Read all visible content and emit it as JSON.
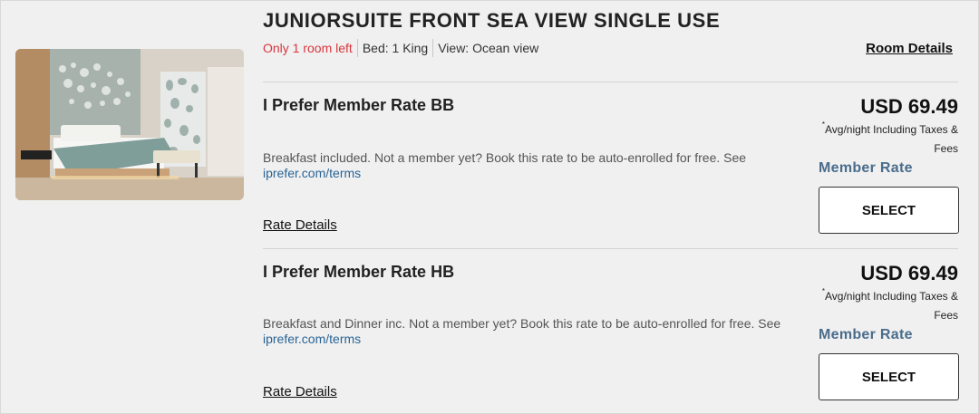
{
  "room": {
    "title": "JUNIORSUITE FRONT SEA VIEW SINGLE USE",
    "availability": "Only 1 room left",
    "bed": "Bed: 1 King",
    "view": "View: Ocean view",
    "details_link": "Room Details",
    "photo_alt": "room-photo"
  },
  "rates": [
    {
      "name": "I Prefer Member Rate BB",
      "description": "Breakfast included. Not a member yet? Book this rate to be auto-enrolled for free. See ",
      "link": "iprefer.com/terms",
      "details_link": "Rate Details",
      "price": "USD 69.49",
      "price_note_mark": "*",
      "price_note": "Avg/night Including Taxes & Fees",
      "member_label": "Member Rate",
      "select_label": "SELECT"
    },
    {
      "name": "I Prefer Member Rate HB",
      "description": "Breakfast and Dinner inc. Not a member yet? Book this rate to be auto-enrolled for free. See ",
      "link": "iprefer.com/terms",
      "details_link": "Rate Details",
      "price": "USD 69.49",
      "price_note_mark": "*",
      "price_note": "Avg/night Including Taxes & Fees",
      "member_label": "Member Rate",
      "select_label": "SELECT"
    }
  ],
  "colors": {
    "availability": "#d9363e",
    "member_rate": "#4a6d8c",
    "link": "#2a6496",
    "background": "#f0f0f0"
  }
}
